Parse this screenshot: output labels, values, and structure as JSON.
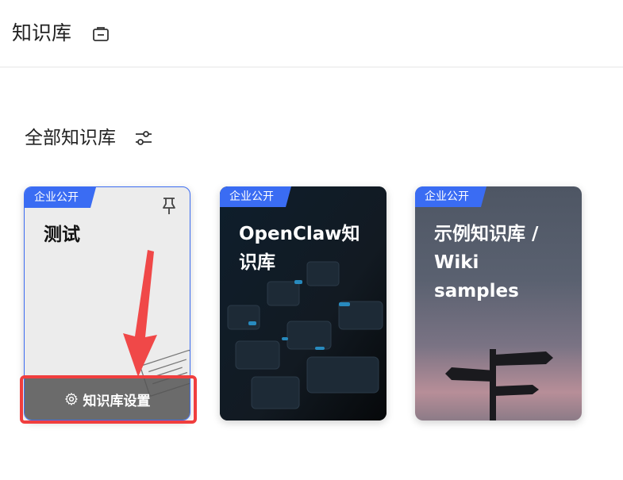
{
  "header": {
    "title": "知识库",
    "icon": "briefcase-icon"
  },
  "section": {
    "title": "全部知识库",
    "filter_icon": "sliders-icon"
  },
  "cards": [
    {
      "badge": "企业公开",
      "title": "测试",
      "pin_icon": "pin-icon",
      "settings_label": "知识库设置",
      "settings_icon": "gear-icon"
    },
    {
      "badge": "企业公开",
      "title": "OpenClaw知识库"
    },
    {
      "badge": "企业公开",
      "title": "示例知识库 / Wiki samples"
    }
  ],
  "colors": {
    "accent": "#3a6cf3",
    "highlight": "#f03e3e"
  }
}
